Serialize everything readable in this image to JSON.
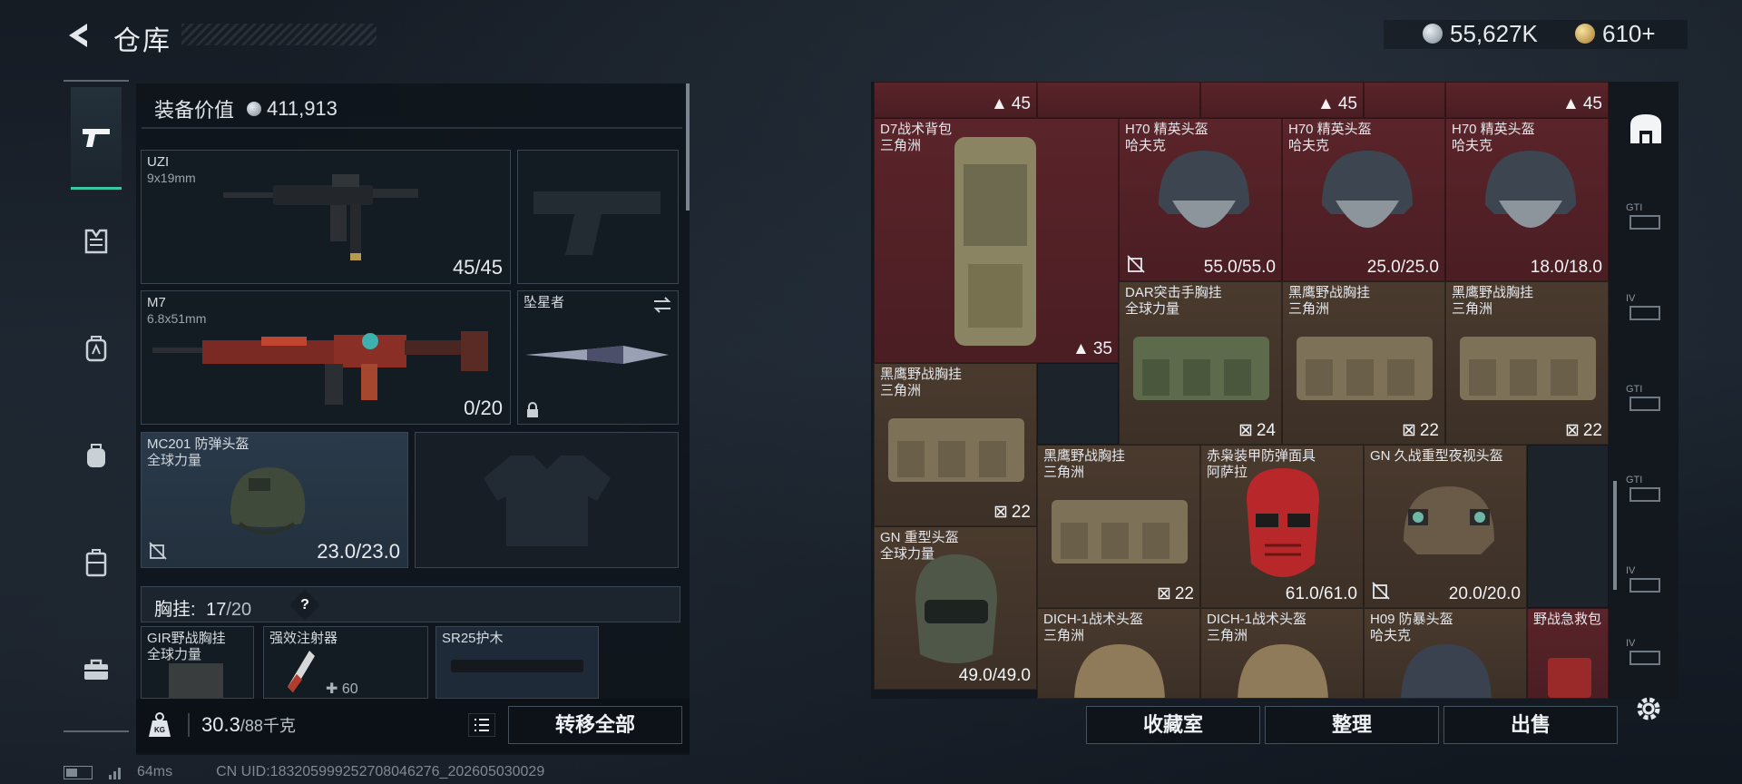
{
  "header": {
    "title": "仓库",
    "currency_silver": "55,627K",
    "currency_gold": "610+"
  },
  "left_sidebar": [
    {
      "icon": "pistol-icon",
      "active": true
    },
    {
      "icon": "vest-icon"
    },
    {
      "icon": "backpack-a-icon"
    },
    {
      "icon": "backpack-icon"
    },
    {
      "icon": "case-icon"
    },
    {
      "icon": "toolbox-icon"
    }
  ],
  "equipment": {
    "value_label": "装备价值",
    "value": "411,913",
    "primary": {
      "name": "UZI",
      "ammo": "9x19mm",
      "durability": "45/45"
    },
    "secondary": {
      "name": "M7",
      "ammo": "6.8x51mm",
      "durability": "0/20"
    },
    "melee": {
      "name": "坠星者"
    },
    "helmet": {
      "name": "MC201 防弹头盔",
      "maker": "全球力量",
      "durability": "23.0/23.0"
    },
    "vest_label": "胸挂:",
    "vest_used": "17",
    "vest_total": "/20",
    "vest_help": "?",
    "vest_items": [
      {
        "name": "GIR野战胸挂",
        "maker": "全球力量"
      },
      {
        "name": "强效注射器",
        "count": "60"
      },
      {
        "name": "SR25护木"
      }
    ],
    "weight": "30.3",
    "weight_unit": "/88千克",
    "weight_icon_text": "KG",
    "transfer_all": "转移全部"
  },
  "stash": {
    "top_row": [
      {
        "val": "45"
      },
      {
        "val": "45"
      },
      {
        "val": "45"
      }
    ],
    "items": [
      {
        "name": "D7战术背包",
        "maker": "三角洲",
        "val": "35"
      },
      {
        "name": "H70 精英头盔",
        "maker": "哈夫克",
        "val": "55.0/55.0"
      },
      {
        "name": "H70 精英头盔",
        "maker": "哈夫克",
        "val": "25.0/25.0"
      },
      {
        "name": "H70 精英头盔",
        "maker": "哈夫克",
        "val": "18.0/18.0"
      },
      {
        "name": "DAR突击手胸挂",
        "maker": "全球力量",
        "val": "24"
      },
      {
        "name": "黑鹰野战胸挂",
        "maker": "三角洲",
        "val": "22"
      },
      {
        "name": "黑鹰野战胸挂",
        "maker": "三角洲",
        "val": "22"
      },
      {
        "name": "黑鹰野战胸挂",
        "maker": "三角洲",
        "val": "22"
      },
      {
        "name": "黑鹰野战胸挂",
        "maker": "三角洲",
        "val": "22"
      },
      {
        "name": "赤枭装甲防弹面具",
        "maker": "阿萨拉",
        "val": "61.0/61.0"
      },
      {
        "name": "GN 久战重型夜视头盔",
        "maker": "",
        "val": "20.0/20.0"
      },
      {
        "name": "GN 重型头盔",
        "maker": "全球力量",
        "val": "49.0/49.0"
      },
      {
        "name": "DICH-1战术头盔",
        "maker": "三角洲",
        "val": ""
      },
      {
        "name": "DICH-1战术头盔",
        "maker": "三角洲",
        "val": ""
      },
      {
        "name": "H09 防暴头盔",
        "maker": "哈夫克",
        "val": ""
      },
      {
        "name": "野战急救包",
        "maker": "",
        "val": ""
      }
    ],
    "buttons": {
      "collection": "收藏室",
      "sort": "整理",
      "sell": "出售"
    }
  },
  "right_sidebar": [
    {
      "icon": "stash-home-icon",
      "active": true
    },
    {
      "icon": "gti-case-icon",
      "label": "GTI"
    },
    {
      "icon": "iv-case-icon",
      "label": "IV"
    },
    {
      "icon": "gti-case-2-icon",
      "label": "GTI"
    },
    {
      "icon": "gti-case-3-icon",
      "label": "GTI"
    },
    {
      "icon": "iv-case-2-icon",
      "label": "IV"
    },
    {
      "icon": "iv-case-3-icon",
      "label": "IV"
    }
  ],
  "status": {
    "ping": "64ms",
    "uid": "CN UID:18320599925270804627​6_202605030029"
  },
  "colors": {
    "accent": "#39c7a6",
    "red_cell": "#5a242a",
    "brown_cell": "#4a3a2e"
  }
}
